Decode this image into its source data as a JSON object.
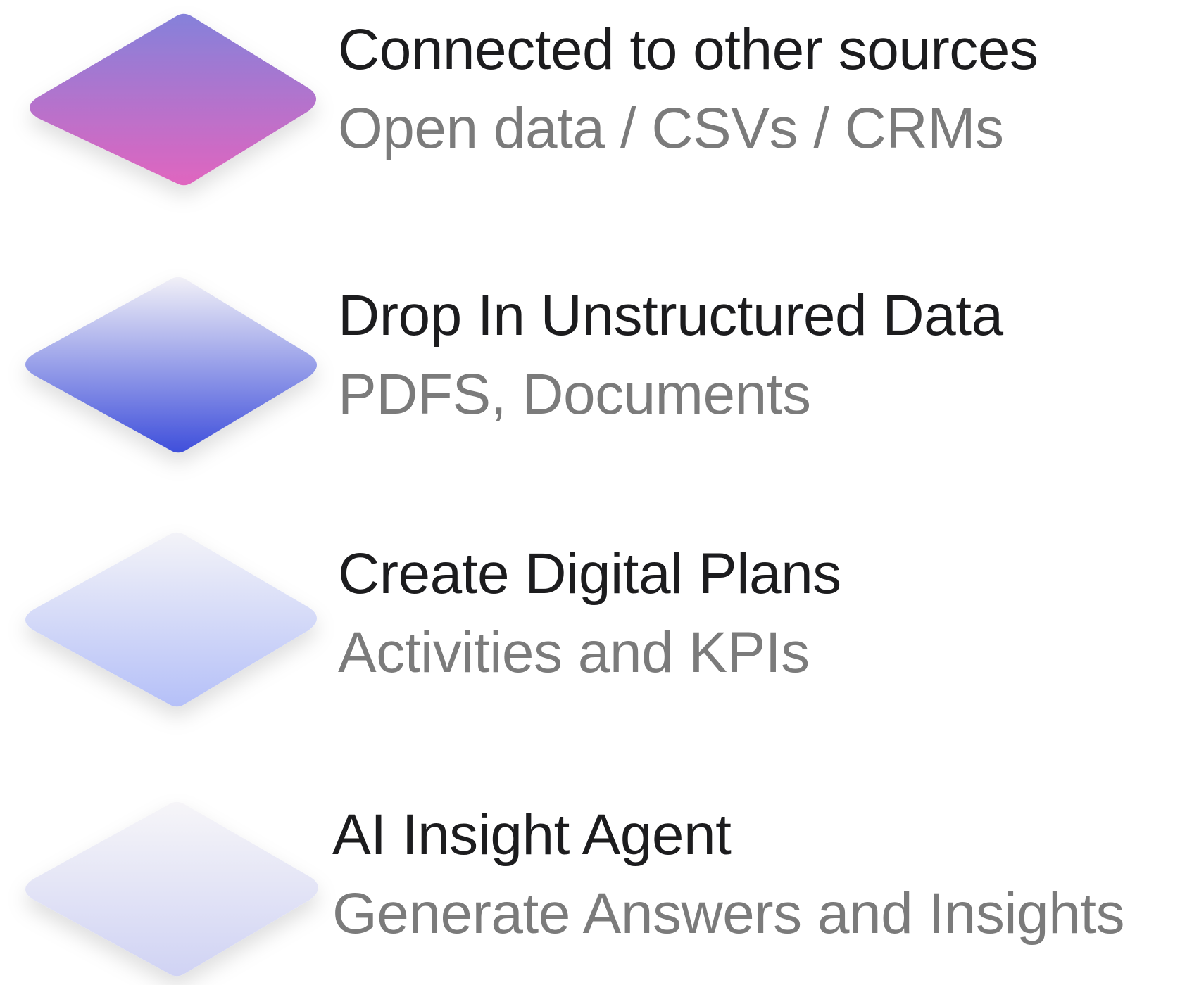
{
  "layers": [
    {
      "title": "Connected to other sources",
      "subtitle": "Open data / CSVs / CRMs",
      "icon": "diamond-layer-icon",
      "gradient": {
        "top": "#8581da",
        "bottom": "#e065bf"
      }
    },
    {
      "title": "Drop In Unstructured Data",
      "subtitle": "PDFS, Documents",
      "icon": "diamond-layer-icon",
      "gradient": {
        "top": "#f1f0f7",
        "bottom": "#3f4fdb"
      }
    },
    {
      "title": "Create Digital Plans",
      "subtitle": "Activities and KPIs",
      "icon": "diamond-layer-icon",
      "gradient": {
        "top": "#f3f3f8",
        "bottom": "#b5c0f8"
      }
    },
    {
      "title": "AI Insight Agent",
      "subtitle": "Generate Answers and Insights",
      "icon": "diamond-layer-icon",
      "gradient": {
        "top": "#f6f5f8",
        "bottom": "#d0d3f4"
      }
    }
  ]
}
